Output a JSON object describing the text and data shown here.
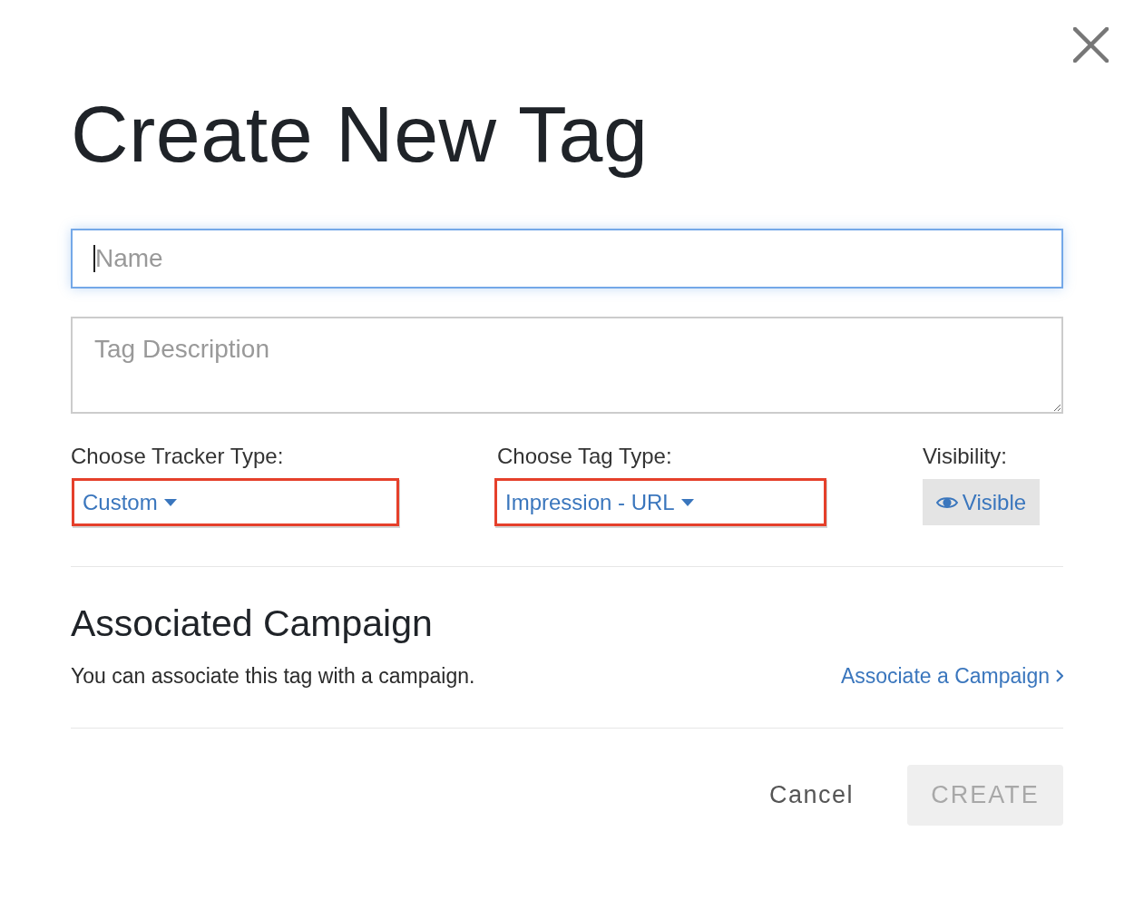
{
  "dialog": {
    "title": "Create New Tag"
  },
  "fields": [
    {
      "kind": "input",
      "placeholder": "Name",
      "focused": true
    },
    {
      "kind": "textarea",
      "placeholder": "Tag Description",
      "focused": false
    }
  ],
  "selectors": [
    {
      "kind": "dropdown",
      "label": "Choose Tracker Type:",
      "value": "Custom",
      "highlighted": true
    },
    {
      "kind": "dropdown",
      "label": "Choose Tag Type:",
      "value": "Impression - URL",
      "highlighted": true
    },
    {
      "kind": "toggle",
      "label": "Visibility:",
      "value": "Visible"
    }
  ],
  "associated_campaign": {
    "heading": "Associated Campaign",
    "description": "You can associate this tag with a campaign.",
    "link": "Associate a Campaign"
  },
  "buttons": [
    {
      "kind": "secondary",
      "label": "Cancel",
      "disabled": false
    },
    {
      "kind": "primary",
      "label": "CREATE",
      "disabled": true
    }
  ]
}
